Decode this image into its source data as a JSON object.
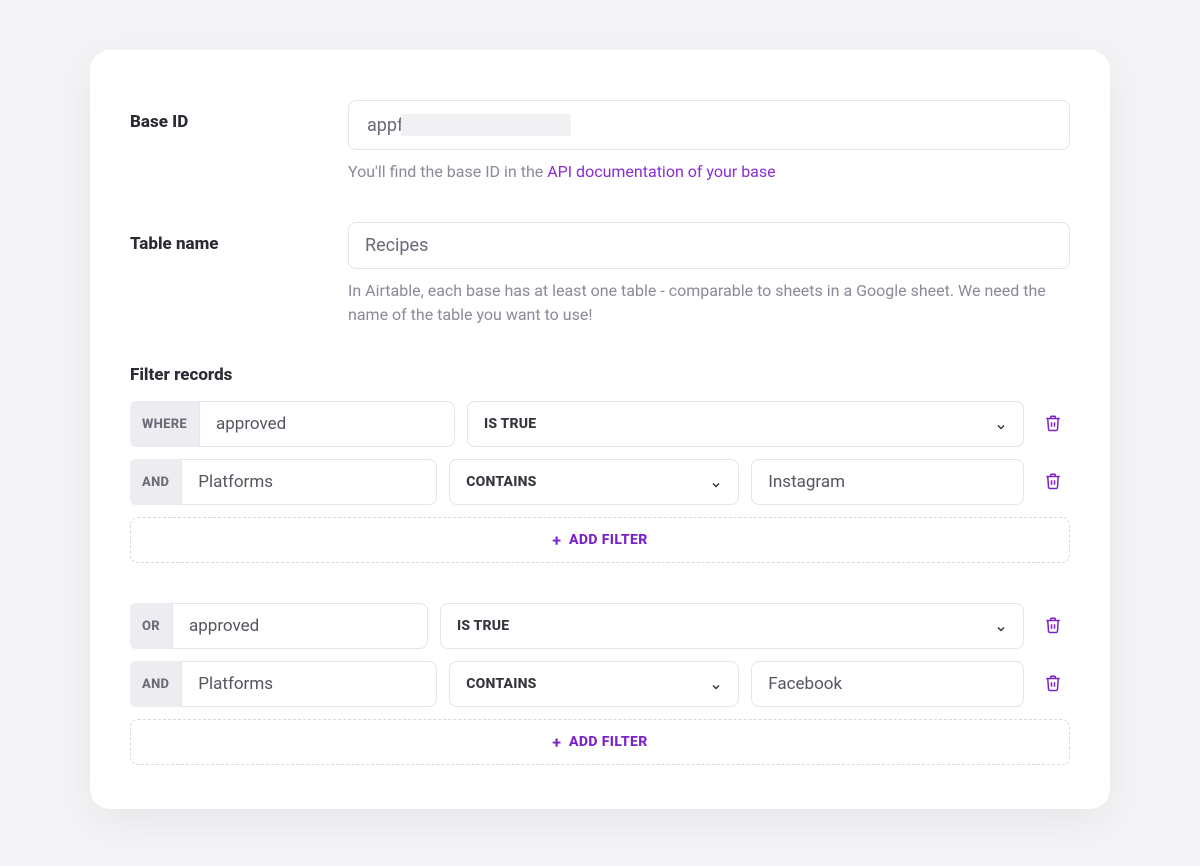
{
  "baseId": {
    "label": "Base ID",
    "value_prefix": "appf",
    "help_before": "You'll find the base ID in the ",
    "help_link": "API documentation of your base"
  },
  "tableName": {
    "label": "Table name",
    "value": "Recipes",
    "help": "In Airtable, each base has at least one table - comparable to sheets in a Google sheet. We need the name of the table you want to use!"
  },
  "filterRecords": {
    "title": "Filter records",
    "addFilterLabel": "ADD FILTER",
    "groups": [
      {
        "rows": [
          {
            "op": "WHERE",
            "field": "approved",
            "condition": "IS TRUE",
            "value": null
          },
          {
            "op": "AND",
            "field": "Platforms",
            "condition": "CONTAINS",
            "value": "Instagram"
          }
        ]
      },
      {
        "rows": [
          {
            "op": "OR",
            "field": "approved",
            "condition": "IS TRUE",
            "value": null
          },
          {
            "op": "AND",
            "field": "Platforms",
            "condition": "CONTAINS",
            "value": "Facebook"
          }
        ]
      }
    ]
  }
}
